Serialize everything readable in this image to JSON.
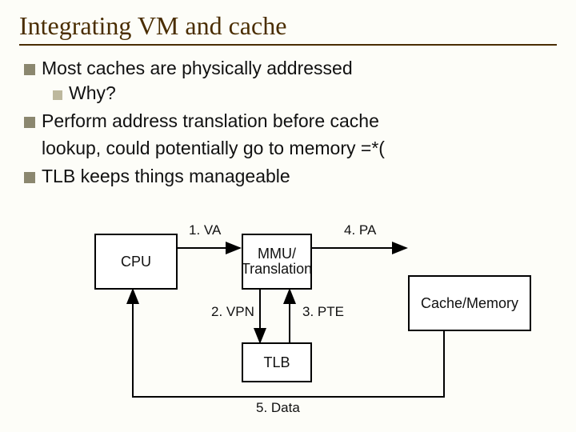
{
  "title": "Integrating VM and cache",
  "bullets": {
    "b1": "Most caches are physically addressed",
    "b1a": "Why?",
    "b2": "Perform address translation before cache",
    "b2_cont": "lookup, could potentially go to memory =*(",
    "b3": "TLB keeps things manageable"
  },
  "diagram": {
    "cpu": "CPU",
    "mmu_l1": "MMU/",
    "mmu_l2": "Translation",
    "tlb": "TLB",
    "cache": "Cache/Memory",
    "l_va": "1. VA",
    "l_vpn": "2. VPN",
    "l_pte": "3. PTE",
    "l_pa": "4. PA",
    "l_data": "5. Data"
  }
}
